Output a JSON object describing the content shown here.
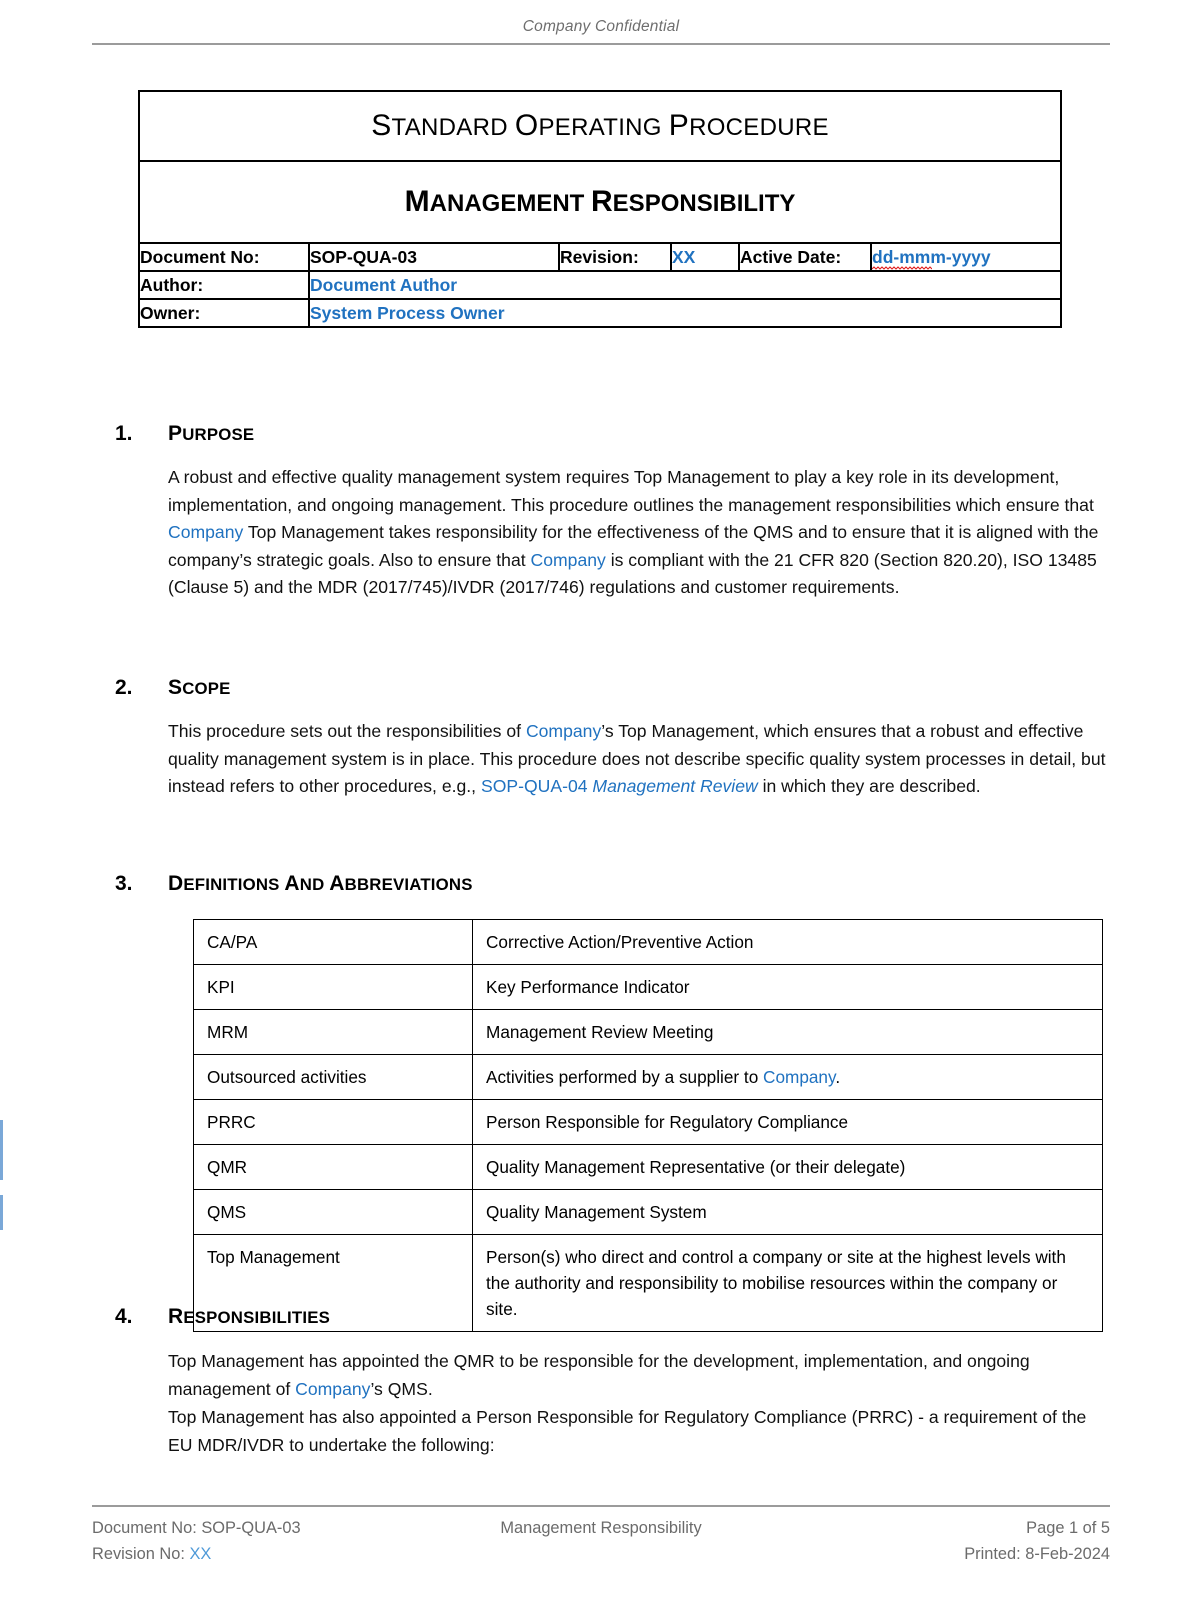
{
  "page_header": {
    "confidential_label": "Company Confidential"
  },
  "title_block": {
    "doc_type_line1": "S",
    "doc_type_rest1": "tandard ",
    "doc_type_line2": "O",
    "doc_type_rest2": "perating ",
    "doc_type_line3": "P",
    "doc_type_rest3": "rocedure",
    "doc_type_full": "Standard Operating Procedure",
    "doc_title_full": "Management Responsibility",
    "doc_title_c1": "M",
    "doc_title_r1": "anagement ",
    "doc_title_c2": "R",
    "doc_title_r2": "esponsibility",
    "document_no_label": "Document No:",
    "document_no_value": "SOP-QUA-03",
    "revision_label": "Revision:",
    "revision_value": "XX",
    "active_date_label": "Active Date:",
    "active_date_value": "dd-mmm-yyyy",
    "author_label": "Author:",
    "author_value": "Document Author",
    "owner_label": "Owner:",
    "owner_value": "System Process Owner"
  },
  "sections": {
    "purpose": {
      "number": "1.",
      "title_cap": "P",
      "title_rest": "urpose",
      "title_full": "PURPOSE",
      "body_1": "A robust and effective quality management system requires Top Management to play a key role in its development, implementation, and ongoing management. This procedure outlines the management responsibilities which ensure that ",
      "company_1": "Company",
      "body_2": " Top Management takes responsibility for the effectiveness of the QMS and to ensure that it is aligned with the company’s strategic goals. Also to ensure that ",
      "company_2": "Company",
      "body_3": " is compliant with the 21 CFR 820 (Section 820.20), ISO 13485 (Clause 5) and the MDR (2017/745)/IVDR (2017/746) regulations and customer requirements."
    },
    "scope": {
      "number": "2.",
      "title_cap": "S",
      "title_rest": "cope",
      "title_full": "SCOPE",
      "body_1": "This procedure sets out the responsibilities of ",
      "company_1": "Company",
      "body_2": "’s Top Management, which ensures that a robust and effective quality management system is in place. This procedure does not describe specific quality system processes in detail, but instead refers to other procedures, e.g., ",
      "link_doc": "SOP-QUA-04",
      "link_title": "Management Review",
      "body_3": " in which they are described."
    },
    "definitions": {
      "number": "3.",
      "title_c1": "D",
      "title_r1": "efinitions ",
      "title_c2": "a",
      "title_r2": "nd ",
      "title_c3": "A",
      "title_r3": "bbreviations",
      "title_full": "DEFINITIONS AND ABBREVIATIONS",
      "rows": [
        {
          "term": "CA/PA",
          "definition": "Corrective Action/Preventive Action"
        },
        {
          "term": "KPI",
          "definition": "Key Performance Indicator"
        },
        {
          "term": "MRM",
          "definition": "Management Review Meeting"
        },
        {
          "term": "Outsourced activities",
          "definition_pre": "Activities performed by a supplier to ",
          "company": "Company",
          "definition_post": "."
        },
        {
          "term": "PRRC",
          "definition": "Person Responsible for Regulatory Compliance"
        },
        {
          "term": "QMR",
          "definition": "Quality Management Representative (or their delegate)"
        },
        {
          "term": "QMS",
          "definition": "Quality Management System"
        },
        {
          "term": "Top Management",
          "definition": "Person(s) who direct and control a company or site at the highest levels with the authority and responsibility to mobilise resources within the company or site."
        }
      ]
    },
    "responsibilities": {
      "number": "4.",
      "title_cap": "R",
      "title_rest": "esponsibilities",
      "title_full": "RESPONSIBILITIES",
      "para1_pre": "Top Management has appointed the QMR to be responsible for the development, implementation, and ongoing management of ",
      "para1_company": "Company",
      "para1_post": "’s QMS.",
      "para2": "Top Management has also appointed a Person Responsible for Regulatory Compliance (PRRC) - a requirement of the EU MDR/IVDR to undertake the following:"
    }
  },
  "page_footer": {
    "document_no": "Document No: SOP-QUA-03",
    "revision_no_label": "Revision No: ",
    "revision_no_value": "XX",
    "center_title": "Management Responsibility",
    "page_indicator": "Page 1 of 5",
    "printed": "Printed:  8-Feb-2024"
  },
  "colors": {
    "accent_blue": "#2072C0",
    "footer_gray": "#6b6b6b",
    "rule_gray": "#9b9b9b",
    "spell_red": "#e01b1b"
  }
}
